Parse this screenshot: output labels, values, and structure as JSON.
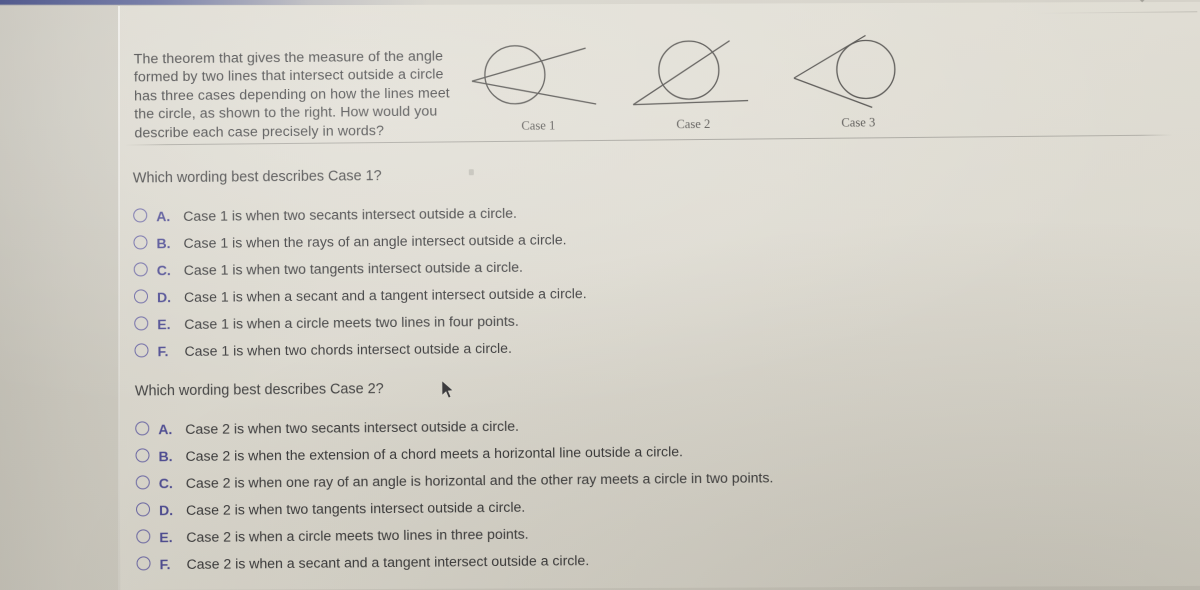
{
  "prompt": {
    "text": "The theorem that gives the measure of the angle formed by two lines that intersect outside a circle has three cases depending on how the lines meet the circle, as shown to the right. How would you describe each case precisely in words?"
  },
  "figures": [
    {
      "caption": "Case 1",
      "description": "two secants intersecting outside the circle on the left"
    },
    {
      "caption": "Case 2",
      "description": "a secant and a tangent intersecting outside the circle on the left"
    },
    {
      "caption": "Case 3",
      "description": "two tangents intersecting outside the circle on the left"
    }
  ],
  "questions": [
    {
      "heading": "Which wording best describes Case 1?",
      "options": [
        {
          "letter": "A.",
          "text": "Case 1 is when two secants intersect outside a circle.",
          "selected": false
        },
        {
          "letter": "B.",
          "text": "Case 1 is when the rays of an angle intersect outside a circle.",
          "selected": false
        },
        {
          "letter": "C.",
          "text": "Case 1 is when two tangents intersect outside a circle.",
          "selected": false
        },
        {
          "letter": "D.",
          "text": "Case 1 is when a secant and a tangent intersect outside a circle.",
          "selected": false
        },
        {
          "letter": "E.",
          "text": "Case 1 is when a circle meets two lines in four points.",
          "selected": false
        },
        {
          "letter": "F.",
          "text": "Case 1 is when two chords intersect outside a circle.",
          "selected": false
        }
      ]
    },
    {
      "heading": "Which wording best describes Case 2?",
      "options": [
        {
          "letter": "A.",
          "text": "Case 2 is when two secants intersect outside a circle.",
          "selected": false
        },
        {
          "letter": "B.",
          "text": "Case 2 is when the extension of a chord meets a horizontal line outside a circle.",
          "selected": false
        },
        {
          "letter": "C.",
          "text": "Case 2 is when one ray of an angle is horizontal and the other ray meets a circle in two points.",
          "selected": false
        },
        {
          "letter": "D.",
          "text": "Case 2 is when two tangents intersect outside a circle.",
          "selected": false
        },
        {
          "letter": "E.",
          "text": "Case 2 is when a circle meets two lines in three points.",
          "selected": false
        },
        {
          "letter": "F.",
          "text": "Case 2 is when a secant and a tangent intersect outside a circle.",
          "selected": false
        }
      ]
    }
  ],
  "colors": {
    "page_background": "#d5d2c8",
    "margin_background": "#c9c6bd",
    "body_text": "#343436",
    "option_letter": "#4c4a95",
    "radio_border": "#6a66a8",
    "divider": "#8c8a84",
    "figure_stroke": "#4a4845",
    "top_chrome": "#2a3578"
  }
}
